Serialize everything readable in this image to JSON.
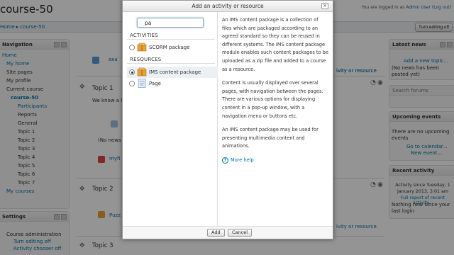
{
  "header": {
    "course_title": "course-50",
    "login_prefix": "You are logged in as",
    "login_user": "Admin User",
    "login_logout": "(Log out)"
  },
  "breadcrumb": {
    "home": "Home",
    "course": "course-50"
  },
  "turn_editing_button": "Turn editing off",
  "navigation": {
    "title": "Navigation",
    "items": [
      {
        "label": "Home",
        "type": "link"
      },
      {
        "label": "My home",
        "type": "link"
      },
      {
        "label": "Site pages",
        "type": "plain"
      },
      {
        "label": "My profile",
        "type": "plain"
      },
      {
        "label": "Current course",
        "type": "plain"
      },
      {
        "label": "course-50",
        "type": "bold"
      },
      {
        "label": "Participants",
        "type": "link"
      },
      {
        "label": "Reports",
        "type": "plain"
      },
      {
        "label": "General",
        "type": "plain"
      },
      {
        "label": "Topic 1",
        "type": "plain"
      },
      {
        "label": "Topic 2",
        "type": "plain"
      },
      {
        "label": "Topic 3",
        "type": "plain"
      },
      {
        "label": "Topic 4",
        "type": "plain"
      },
      {
        "label": "Topic 5",
        "type": "plain"
      },
      {
        "label": "Topic 6",
        "type": "plain"
      },
      {
        "label": "Topic 7",
        "type": "plain"
      },
      {
        "label": "My courses",
        "type": "link"
      }
    ]
  },
  "settings": {
    "title": "Settings",
    "items": [
      "Course administration",
      "Turn editing off",
      "Activity chooser off"
    ]
  },
  "course": {
    "topic1_title": "Topic 1",
    "topic1_text": "We know a li",
    "topic1_news": "(No news",
    "topic1_link": "myfi",
    "topic2_title": "Topic 2",
    "topic2_link": "Puzz",
    "topic3_title": "Topic 3",
    "example_link": "exa",
    "add_activity_1": "ivity or resource",
    "add_activity_2": "ivity or resource",
    "add_activity_3": "ivity or resource"
  },
  "latest_news": {
    "title": "Latest news",
    "add_link": "Add a new topic...",
    "text": "(No news has been posted yet)"
  },
  "search_forums": {
    "title": "Search forums"
  },
  "upcoming_events": {
    "title": "Upcoming events",
    "text": "There are no upcoming events",
    "calendar_link": "Go to calendar...",
    "new_event_link": "New event..."
  },
  "recent_activity": {
    "title": "Recent activity",
    "since": "Activity since Tuesday, 1 January 2013, 3:01 am",
    "full_report": "Full report of recent activity...",
    "nothing": "Nothing new since your last login"
  },
  "dialog": {
    "title": "Add an activity or resource",
    "search_value": "pa",
    "activities_label": "ACTIVITIES",
    "resources_label": "RESOURCES",
    "options": [
      {
        "label": "SCORM package",
        "selected": false,
        "icon": "scorm-package-icon"
      },
      {
        "label": "IMS content package",
        "selected": true,
        "icon": "ims-package-icon"
      },
      {
        "label": "Page",
        "selected": false,
        "icon": "page-icon"
      }
    ],
    "description": [
      "An IMS content package is a collection of files which are packaged according to an agreed standard so they can be reused in different systems. The IMS content package module enables such content packages to be uploaded as a zip file and added to a course as a resource.",
      "Content is usually displayed over several pages, with navigation between the pages. There are various options for displaying content in a pop-up window, with a navigation menu or buttons etc.",
      "An IMS content package may be used for presenting multimedia content and animations."
    ],
    "more_help": "More help",
    "add_button": "Add",
    "cancel_button": "Cancel"
  },
  "colors": {
    "link": "#0070a8",
    "overlay": "rgba(0,0,0,0.42)",
    "package_orange": "#e8a23a"
  }
}
